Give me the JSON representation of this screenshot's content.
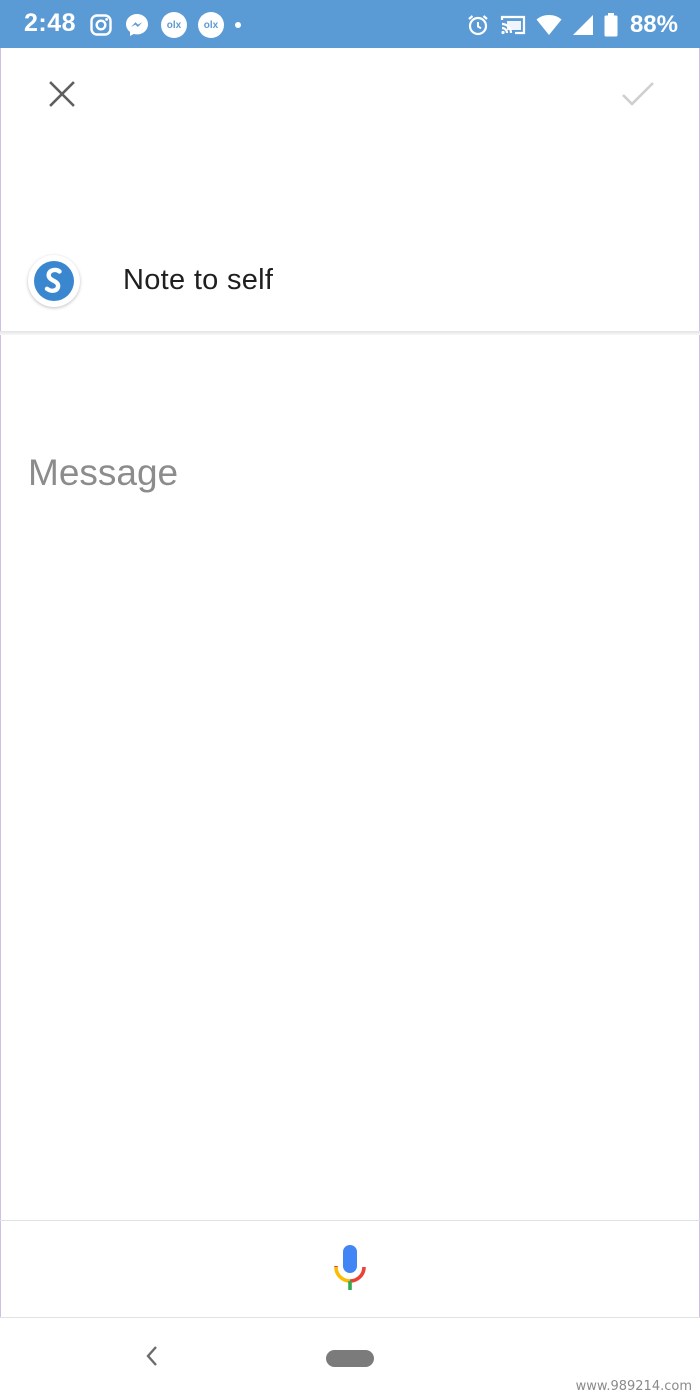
{
  "status_bar": {
    "time": "2:48",
    "battery_percent": "88%",
    "left_icons": [
      "instagram-icon",
      "messenger-icon",
      "olx-icon",
      "olx-icon",
      "notification-dot-icon"
    ],
    "right_icons": [
      "alarm-icon",
      "cast-icon",
      "wifi-icon",
      "signal-icon",
      "battery-icon"
    ],
    "olx_badge_text": "olx",
    "color": "#5b9bd5"
  },
  "toolbar": {
    "close_icon": "close-icon",
    "confirm_icon": "check-icon"
  },
  "recipient": {
    "name": "Note to self",
    "app_icon": "simple-note-logo-icon",
    "logo_color": "#3a87d0"
  },
  "message": {
    "placeholder": "Message",
    "value": ""
  },
  "voice": {
    "icon": "google-mic-icon"
  },
  "nav": {
    "back_icon": "nav-back-icon",
    "home_icon": "nav-home-pill"
  },
  "watermark": "www.989214.com"
}
